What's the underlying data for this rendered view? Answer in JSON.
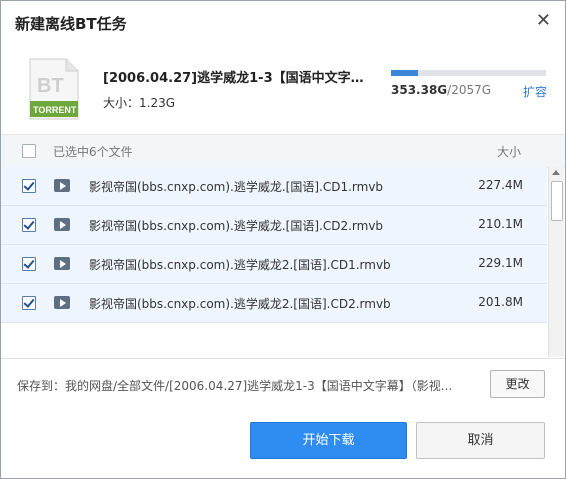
{
  "dialog": {
    "title": "新建离线BT任务"
  },
  "icons": {
    "close": "close-icon",
    "torrent": "bt-torrent-file-icon",
    "video": "video-file-icon"
  },
  "torrent": {
    "badge_top": "BT",
    "badge_bottom": "TORRENT",
    "name": "[2006.04.27]逃学威龙1-3【国语中文字幕...",
    "size_label": "大小：1.23G"
  },
  "storage": {
    "used": "353.38G",
    "total": "/2057G",
    "used_fraction": 0.172,
    "expand_label": "扩容"
  },
  "list": {
    "header_label": "已选中6个文件",
    "size_header": "大小",
    "header_checked": false,
    "rows": [
      {
        "name": "影视帝国(bbs.cnxp.com).逃学威龙.[国语].CD1.rmvb",
        "size": "227.4M",
        "checked": true
      },
      {
        "name": "影视帝国(bbs.cnxp.com).逃学威龙.[国语].CD2.rmvb",
        "size": "210.1M",
        "checked": true
      },
      {
        "name": "影视帝国(bbs.cnxp.com).逃学威龙2.[国语].CD1.rmvb",
        "size": "229.1M",
        "checked": true
      },
      {
        "name": "影视帝国(bbs.cnxp.com).逃学威龙2.[国语].CD2.rmvb",
        "size": "201.8M",
        "checked": true
      }
    ]
  },
  "save": {
    "label": "保存到：",
    "path": "我的网盘/全部文件/[2006.04.27]逃学威龙1-3【国语中文字幕】（影视...",
    "change_label": "更改"
  },
  "buttons": {
    "start": "开始下载",
    "cancel": "取消"
  },
  "colors": {
    "primary": "#2f8cf0",
    "progress": "#3b86d8",
    "torrent_green": "#6fa83a",
    "link": "#2f7bd2"
  }
}
